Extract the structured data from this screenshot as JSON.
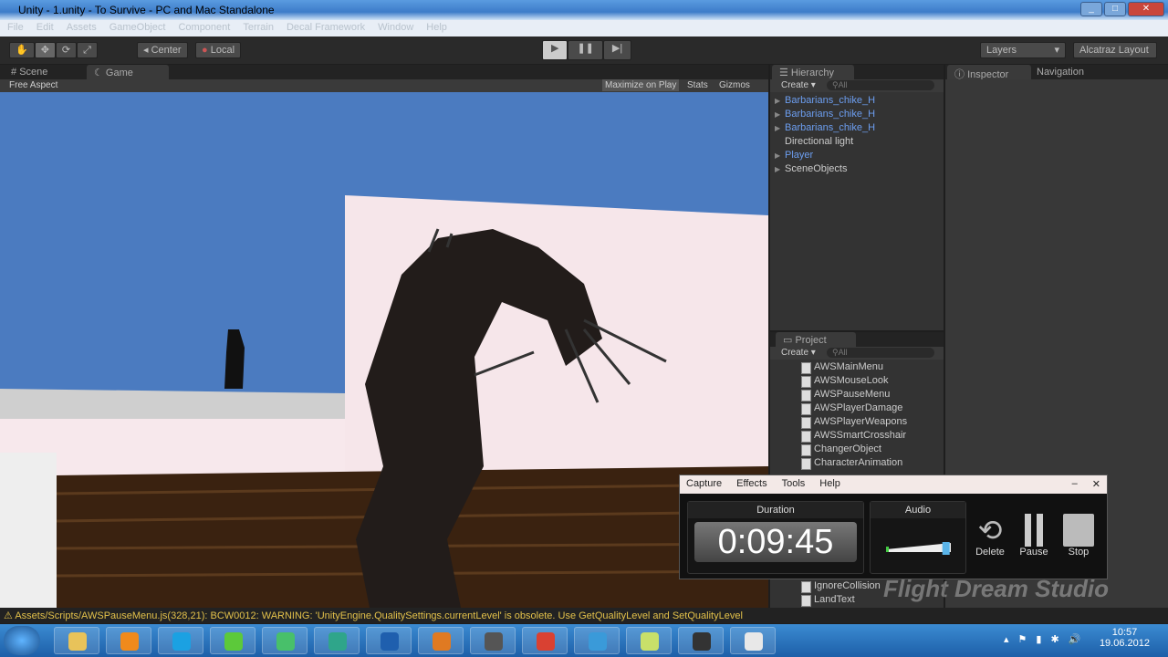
{
  "window": {
    "title": "Unity - 1.unity - To Survive - PC and Mac Standalone"
  },
  "menu": [
    "File",
    "Edit",
    "Assets",
    "GameObject",
    "Component",
    "Terrain",
    "Decal Framework",
    "Window",
    "Help"
  ],
  "toolbar": {
    "pivot": "Center",
    "space": "Local",
    "layers": "Layers",
    "layout": "Alcatraz Layout"
  },
  "game_tabs": {
    "scene": "Scene",
    "game": "Game",
    "aspect": "Free Aspect",
    "maximize": "Maximize on Play",
    "stats": "Stats",
    "gizmos": "Gizmos"
  },
  "hierarchy": {
    "title": "Hierarchy",
    "create": "Create",
    "search": "All",
    "items": [
      {
        "label": "Barbarians_chike_H",
        "prefab": true,
        "expandable": true
      },
      {
        "label": "Barbarians_chike_H",
        "prefab": true,
        "expandable": true
      },
      {
        "label": "Barbarians_chike_H",
        "prefab": true,
        "expandable": true
      },
      {
        "label": "Directional light",
        "prefab": false,
        "expandable": false
      },
      {
        "label": "Player",
        "prefab": true,
        "expandable": true
      },
      {
        "label": "SceneObjects",
        "prefab": false,
        "expandable": true
      }
    ]
  },
  "inspector": {
    "title": "Inspector",
    "navigation": "Navigation"
  },
  "project": {
    "title": "Project",
    "create": "Create",
    "search": "All",
    "items": [
      "AWSMainMenu",
      "AWSMouseLook",
      "AWSPauseMenu",
      "AWSPlayerDamage",
      "AWSPlayerWeapons",
      "AWSSmartCrosshair",
      "ChangerObject",
      "CharacterAnimation"
    ],
    "items_bottom": [
      "IgnoreCollision",
      "LandText"
    ]
  },
  "status": "Assets/Scripts/AWSPauseMenu.js(328,21): BCW0012: WARNING: 'UnityEngine.QualitySettings.currentLevel' is obsolete. Use GetQualityLevel and SetQualityLevel",
  "recorder": {
    "menu": [
      "Capture",
      "Effects",
      "Tools",
      "Help"
    ],
    "duration_label": "Duration",
    "duration": "0:09:45",
    "audio_label": "Audio",
    "audio_level": 0.9,
    "delete": "Delete",
    "pause": "Pause",
    "stop": "Stop"
  },
  "watermark": "Flight Dream Studio",
  "clock": {
    "time": "10:57",
    "date": "19.06.2012"
  },
  "colors": {
    "accent": "#6c9ef0",
    "warning": "#e3c14a",
    "sky": "#4b7bc0"
  }
}
